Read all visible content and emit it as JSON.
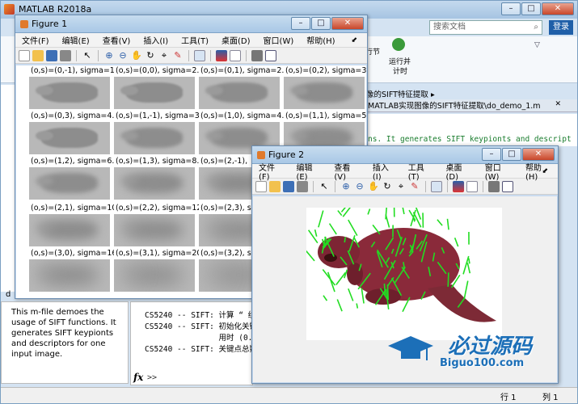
{
  "matlab": {
    "title": "MATLAB R2018a",
    "search_placeholder": "搜索文档",
    "login_label": "登录",
    "ribbon": {
      "btn1_line1": "行节",
      "btn1_line2": "",
      "btn2_line1": "运行并",
      "btn2_line2": "计时"
    },
    "addr_fragment": "像的SIFT特征提取 ▸",
    "editor_tab": "MATLAB实现图像的SIFT特征提取\\do_demo_1.m",
    "editor_line": "ns. It generates SIFT keypionts and descript",
    "help_text": "This m-file demoes the usage of SIFT functions. It generates SIFT keypionts and descriptors for one input image.",
    "command_lines": [
      "CS5240 -- SIFT: 计算 “ 组",
      "CS5240 -- SIFT: 初始化关键",
      "                用时 (0.0",
      "CS5240 -- SIFT: 关键点总数"
    ],
    "prompt": ">>",
    "fx": "fx",
    "status_row": "行 1",
    "status_col": "列 1",
    "side_d": "d"
  },
  "figure1": {
    "title": "Figure 1",
    "menu": [
      "文件(F)",
      "编辑(E)",
      "查看(V)",
      "插入(I)",
      "工具(T)",
      "桌面(D)",
      "窗口(W)",
      "帮助(H)"
    ],
    "rows": [
      [
        "(o,s)=(0,-1), sigma=1.6",
        "(o,s)=(0,0), sigma=2.0",
        "(o,s)=(0,1), sigma=2.5",
        "(o,s)=(0,2), sigma=3"
      ],
      [
        "(o,s)=(0,3), sigma=4.0",
        "(o,s)=(1,-1), sigma=3.2",
        "(o,s)=(1,0), sigma=4.0",
        "(o,s)=(1,1), sigma=5"
      ],
      [
        "(o,s)=(1,2), sigma=6.4",
        "(o,s)=(1,3), sigma=8.0",
        "(o,s)=(2,-1),",
        ""
      ],
      [
        "(o,s)=(2,1), sigma=10.",
        "(o,s)=(2,2), sigma=12.",
        "(o,s)=(2,3), s",
        ""
      ],
      [
        "(o,s)=(3,0), sigma=16.",
        "(o,s)=(3,1), sigma=20.",
        "(o,s)=(3,2), s",
        ""
      ]
    ]
  },
  "figure2": {
    "title": "Figure 2",
    "menu": [
      "文件(F)",
      "编辑(E)",
      "查看(V)",
      "插入(I)",
      "工具(T)",
      "桌面(D)",
      "窗口(W)",
      "帮助(H)"
    ]
  },
  "watermark": {
    "cn": "必过源码",
    "url": "Biguo100.com"
  },
  "colors": {
    "accent": "#1c6fb8",
    "keypoint": "#22dd22",
    "beaver": "#8a2a3a"
  }
}
